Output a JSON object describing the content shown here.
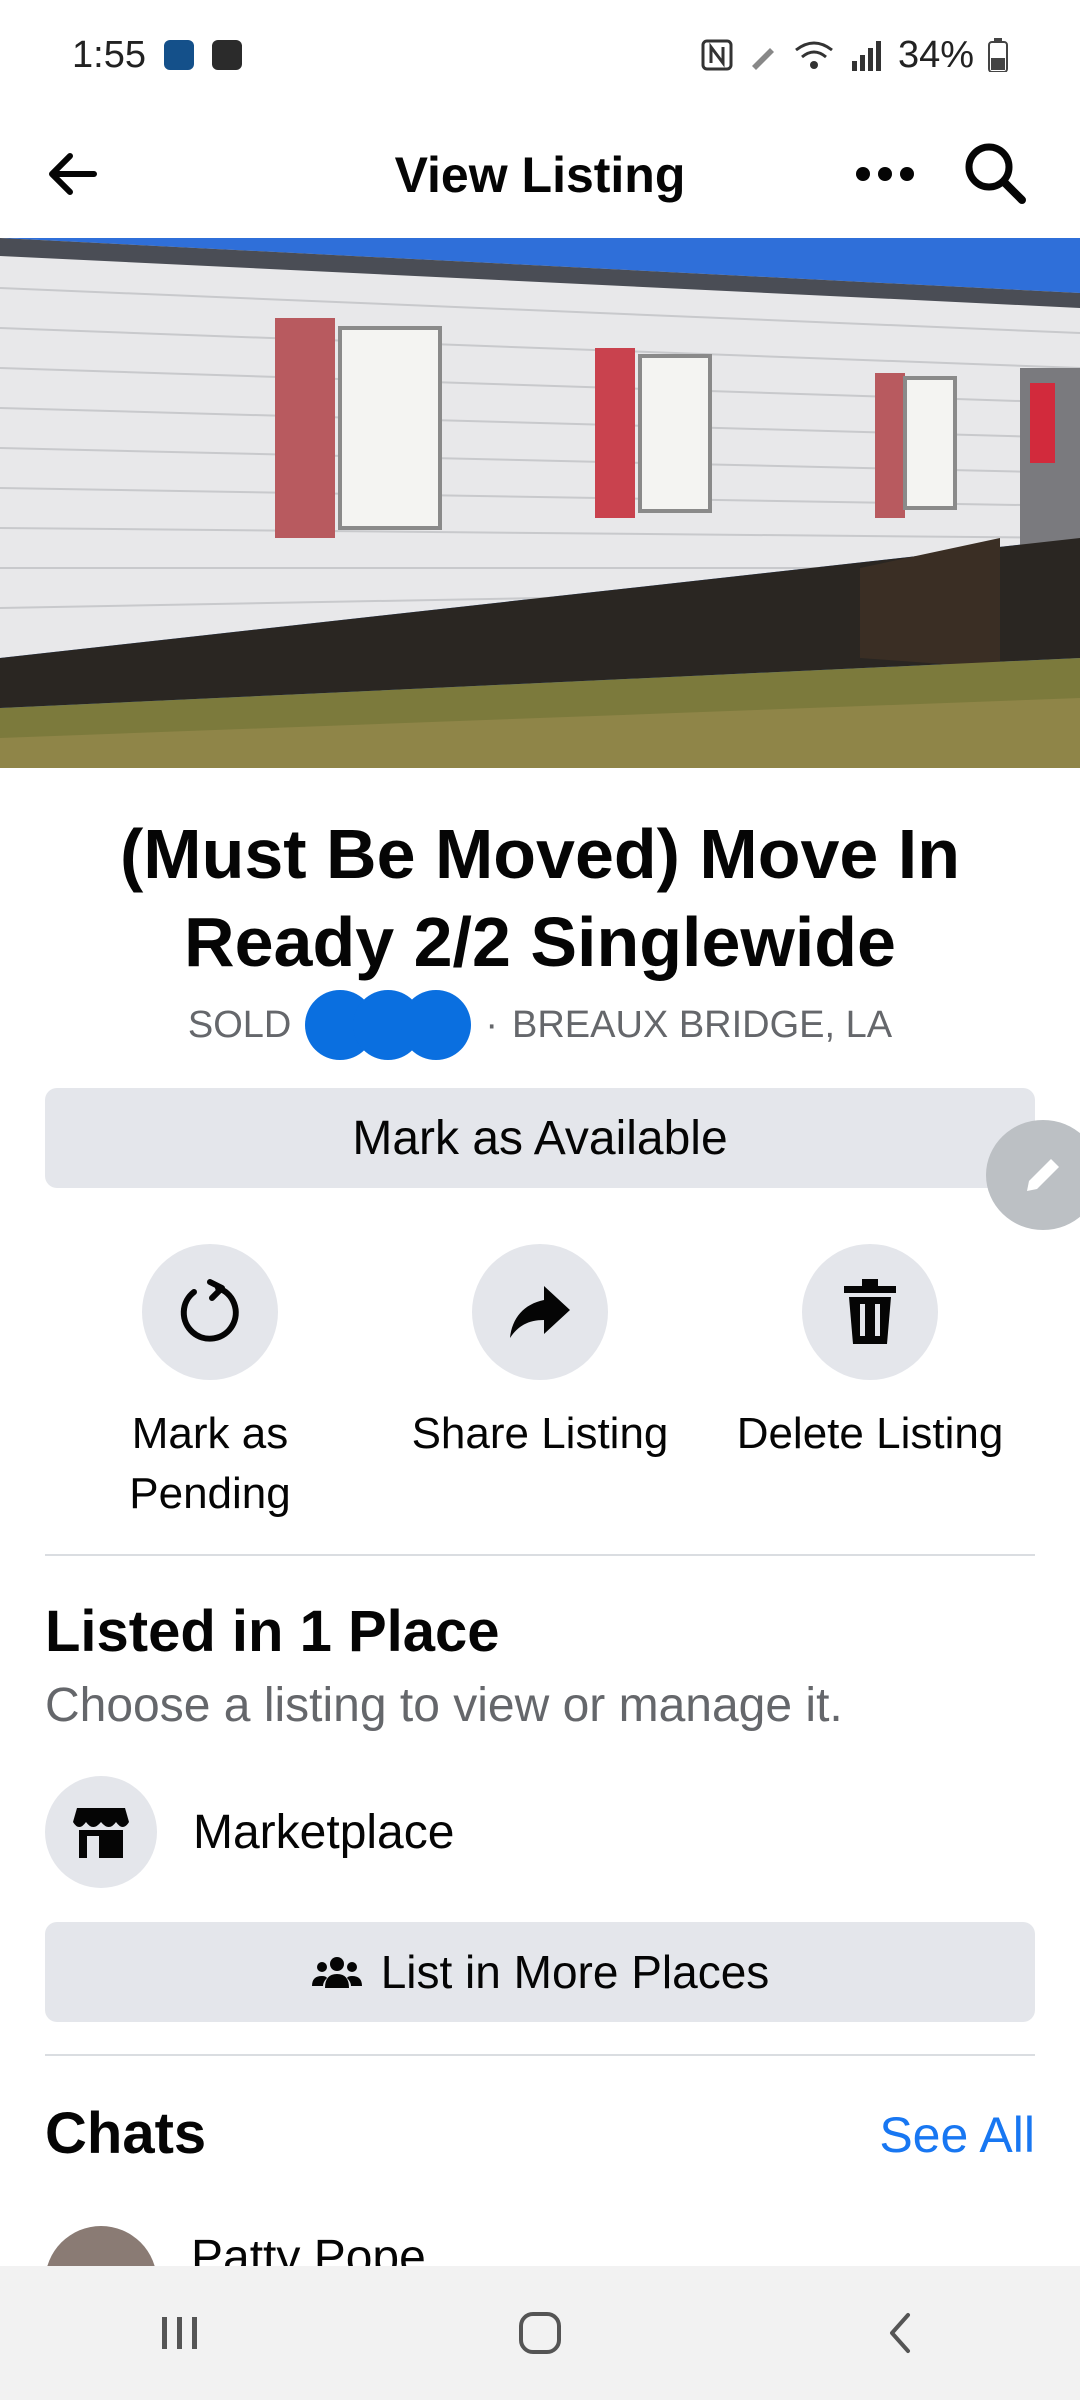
{
  "status_bar": {
    "time": "1:55",
    "battery": "34%"
  },
  "header": {
    "title": "View Listing",
    "back_icon": "arrow-left-icon",
    "more_icon": "more-dots-icon",
    "search_icon": "search-icon"
  },
  "listing": {
    "title": "(Must Be Moved) Move In Ready 2/2 Singlewide",
    "status": "SOLD",
    "separator": "·",
    "location": "BREAUX BRIDGE, LA"
  },
  "primary_action": {
    "label": "Mark as Available"
  },
  "actions": [
    {
      "label": "Mark as Pending",
      "icon": "refresh-icon"
    },
    {
      "label": "Share Listing",
      "icon": "share-arrow-icon"
    },
    {
      "label": "Delete Listing",
      "icon": "trash-icon"
    }
  ],
  "listed_section": {
    "title": "Listed in 1 Place",
    "subtitle": "Choose a listing to view or manage it.",
    "places": [
      {
        "label": "Marketplace",
        "icon": "storefront-icon"
      }
    ],
    "list_more_label": "List in More Places"
  },
  "chats_section": {
    "title": "Chats",
    "see_all": "See All",
    "items": [
      {
        "name": "Patty Pope"
      }
    ]
  },
  "colors": {
    "accent": "#1877f2",
    "button_bg": "#e4e6eb",
    "muted_text": "#65676b"
  }
}
